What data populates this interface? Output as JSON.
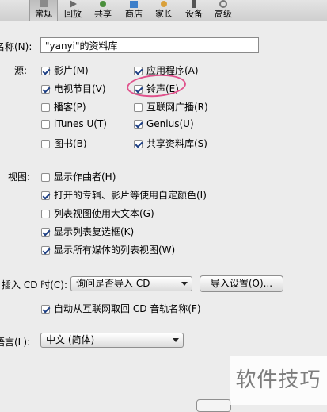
{
  "toolbar": {
    "tabs": [
      {
        "label": "常规",
        "icon": "general-icon"
      },
      {
        "label": "回放",
        "icon": "playback-icon"
      },
      {
        "label": "共享",
        "icon": "sharing-icon"
      },
      {
        "label": "商店",
        "icon": "store-icon"
      },
      {
        "label": "家长",
        "icon": "parental-icon"
      },
      {
        "label": "设备",
        "icon": "devices-icon"
      },
      {
        "label": "高级",
        "icon": "advanced-icon"
      }
    ],
    "selected": "常规"
  },
  "library_name": {
    "label": "名称(N):",
    "value": "\"yanyi\"的资料库"
  },
  "sources": {
    "label": "源:",
    "items": [
      {
        "label": "影片(M)",
        "checked": true
      },
      {
        "label": "应用程序(A)",
        "checked": true
      },
      {
        "label": "电视节目(V)",
        "checked": true
      },
      {
        "label": "铃声(E)",
        "checked": true
      },
      {
        "label": "播客(P)",
        "checked": false
      },
      {
        "label": "互联网广播(R)",
        "checked": false
      },
      {
        "label": "iTunes U(T)",
        "checked": false
      },
      {
        "label": "Genius(U)",
        "checked": true
      },
      {
        "label": "图书(B)",
        "checked": false
      },
      {
        "label": "共享资料库(S)",
        "checked": true
      }
    ]
  },
  "views": {
    "label": "视图:",
    "items": [
      {
        "label": "显示作曲者(H)",
        "checked": false
      },
      {
        "label": "打开的专辑、影片等使用自定颜色(I)",
        "checked": true
      },
      {
        "label": "列表视图使用大文本(G)",
        "checked": false
      },
      {
        "label": "显示列表复选框(K)",
        "checked": true
      },
      {
        "label": "显示所有媒体的列表视图(W)",
        "checked": true
      }
    ]
  },
  "cd": {
    "label": "插入 CD 时(C):",
    "selected_option": "询问是否导入 CD",
    "import_settings_button": "导入设置(O)...",
    "auto_retrieve": {
      "label": "自动从互联网取回 CD 音轨名称(F)",
      "checked": true
    }
  },
  "language": {
    "label": "语言(L):",
    "selected_option": "中文 (简体)"
  },
  "watermark": "软件技巧",
  "colors": {
    "annotation_ring": "#e0528c",
    "check_mark": "#1d3f84"
  }
}
